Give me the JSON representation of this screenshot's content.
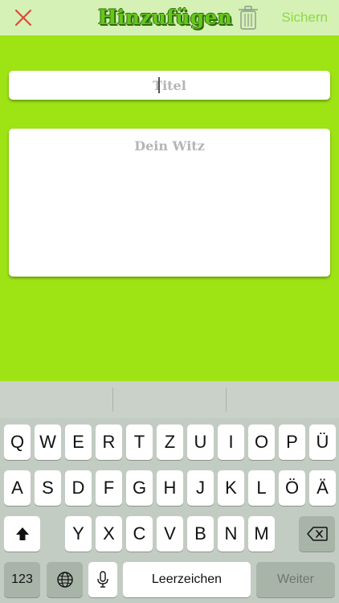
{
  "header": {
    "title": "Hinzufügen",
    "save_label": "Sichern",
    "close_icon": "close-icon",
    "trash_icon": "trash-icon",
    "colors": {
      "close": "#e0473a",
      "title": "#66c71a",
      "save": "#8bd94a",
      "bar": "#d6f1b6"
    }
  },
  "form": {
    "title_placeholder": "Titel",
    "title_value": "",
    "joke_placeholder": "Dein Witz",
    "joke_value": ""
  },
  "background_color": "#9ee414",
  "keyboard": {
    "row1": [
      "Q",
      "W",
      "E",
      "R",
      "T",
      "Z",
      "U",
      "I",
      "O",
      "P",
      "Ü"
    ],
    "row2": [
      "A",
      "S",
      "D",
      "F",
      "G",
      "H",
      "J",
      "K",
      "L",
      "Ö",
      "Ä"
    ],
    "row3": [
      "Y",
      "X",
      "C",
      "V",
      "B",
      "N",
      "M"
    ],
    "numbers_label": "123",
    "space_label": "Leerzeichen",
    "return_label": "Weiter",
    "icons": {
      "shift": "shift-icon",
      "delete": "backspace-icon",
      "globe": "globe-icon",
      "mic": "microphone-icon"
    }
  }
}
